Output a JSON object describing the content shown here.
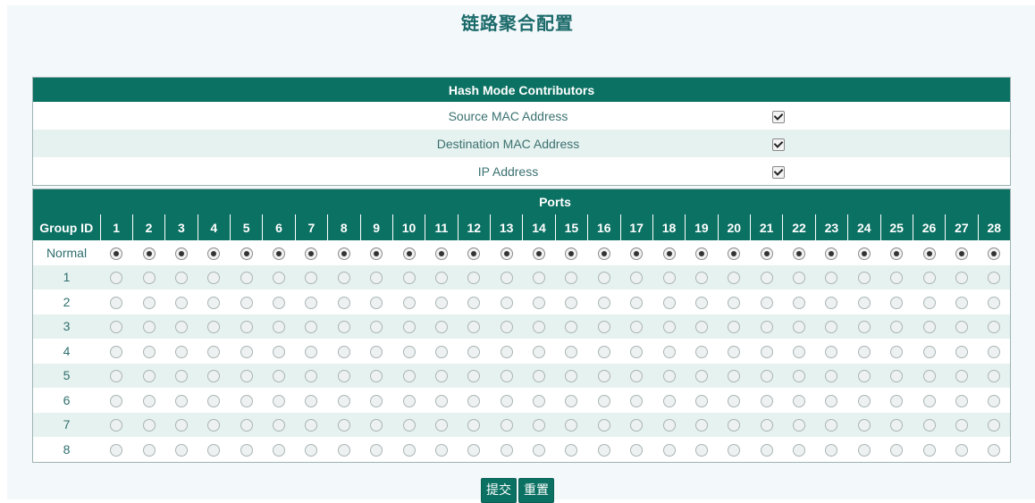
{
  "page": {
    "title": "链路聚合配置"
  },
  "hash": {
    "header": "Hash Mode Contributors",
    "rows": [
      {
        "label": "Source MAC Address",
        "checked": true
      },
      {
        "label": "Destination MAC Address",
        "checked": true
      },
      {
        "label": "IP Address",
        "checked": true
      }
    ]
  },
  "ports": {
    "header": "Ports",
    "group_id_header": "Group ID",
    "port_numbers": [
      "1",
      "2",
      "3",
      "4",
      "5",
      "6",
      "7",
      "8",
      "9",
      "10",
      "11",
      "12",
      "13",
      "14",
      "15",
      "16",
      "17",
      "18",
      "19",
      "20",
      "21",
      "22",
      "23",
      "24",
      "25",
      "26",
      "27",
      "28"
    ],
    "groups": [
      "Normal",
      "1",
      "2",
      "3",
      "4",
      "5",
      "6",
      "7",
      "8"
    ],
    "selected_group": "Normal"
  },
  "buttons": {
    "submit": "提交",
    "reset": "重置"
  }
}
